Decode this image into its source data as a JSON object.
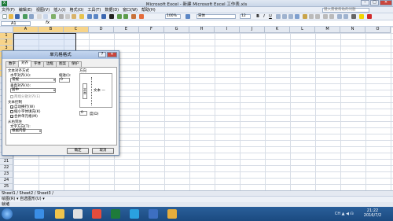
{
  "window": {
    "title": "Microsoft Excel - 新建 Microsoft Excel 工作表.xls",
    "minimize": "–",
    "maximize": "□",
    "close": "✕"
  },
  "menu": {
    "items": [
      "文件(F)",
      "编辑(E)",
      "视图(V)",
      "插入(I)",
      "格式(O)",
      "工具(T)",
      "数据(D)",
      "窗口(W)",
      "帮助(H)"
    ],
    "help_placeholder": "键入需要帮助的问题"
  },
  "toolbar": {
    "zoom": "100%",
    "font": "宋体",
    "size": "12"
  },
  "formula": {
    "name_box": "A1",
    "fx": "fx"
  },
  "grid": {
    "columns": [
      "A",
      "B",
      "C",
      "D",
      "E",
      "F",
      "G",
      "H",
      "I",
      "J",
      "K",
      "L",
      "M",
      "N",
      "O"
    ],
    "rows": [
      "1",
      "2",
      "3",
      "4",
      "5",
      "6",
      "7",
      "8",
      "9",
      "10",
      "11",
      "12",
      "13",
      "14",
      "15",
      "16",
      "17",
      "18",
      "19",
      "20",
      "21",
      "22",
      "23",
      "24",
      "25",
      "26"
    ]
  },
  "sheet_tabs": "Sheet1 / Sheet2 / Sheet3 /",
  "drawbar": "绘图(R) ▾   自选图形(U) ▾",
  "status": "就绪",
  "taskbar": {
    "time": "21:22",
    "date": "2016/7/2",
    "tray": "CH ▲ ◀ ☊"
  },
  "dialog": {
    "title": "单元格格式",
    "tabs": [
      "数字",
      "对齐",
      "字体",
      "边框",
      "图案",
      "保护"
    ],
    "active_tab": 1,
    "text_align_section": "文本对齐方式",
    "horizontal_label": "水平对齐(H):",
    "horizontal_value": "常规",
    "indent_label": "缩进(I):",
    "indent_value": "0",
    "vertical_label": "垂直对齐(V):",
    "vertical_value": "居中",
    "justify_distributed": "两端分散对齐(E)",
    "text_control_section": "文本控制",
    "wrap_text": "自动换行(W)",
    "shrink_to_fit": "缩小字体填充(K)",
    "merge_cells": "合并单元格(M)",
    "rtl_section": "从右到左",
    "text_direction_label": "文字方向(T):",
    "text_direction_value": "根据内容",
    "orientation_label": "方向",
    "orient_vertical_text": "文本",
    "orient_horizontal_text": "文本 —",
    "degrees_value": "0",
    "degrees_label": "度(D)",
    "ok_label": "确定",
    "cancel_label": "取消",
    "wrap_checked": true,
    "shrink_checked": false,
    "merge_checked": true
  }
}
